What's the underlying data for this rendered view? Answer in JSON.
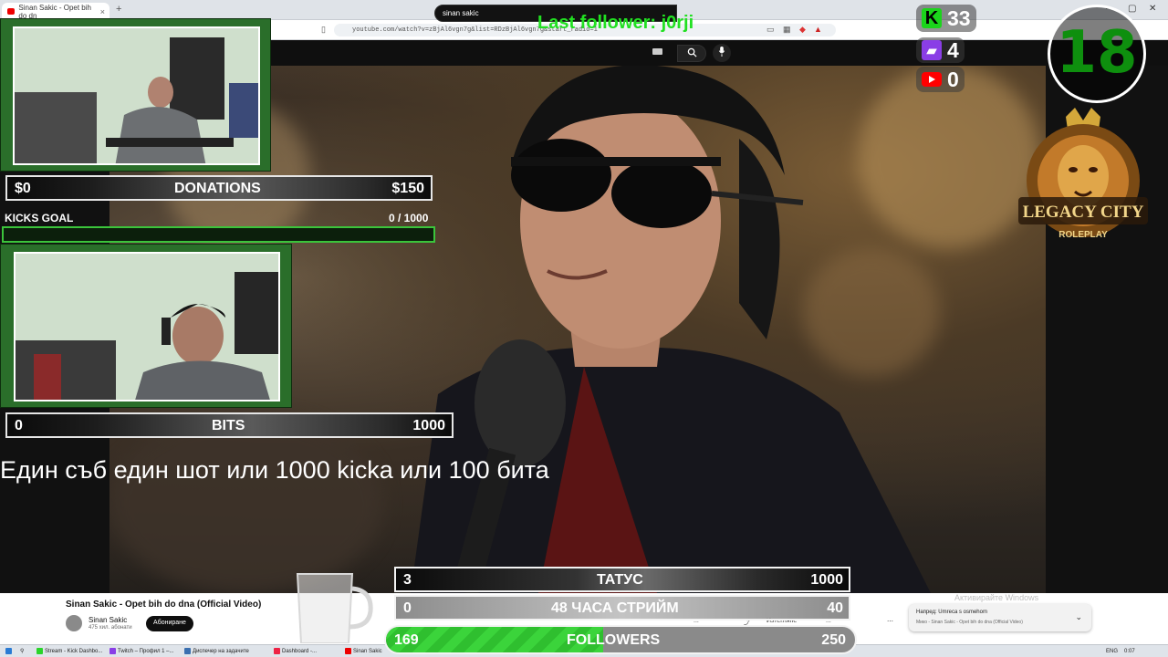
{
  "browser": {
    "tab_title": "Sinan Sakic - Opet bih do dn",
    "new_tab": "+",
    "close_tab": "×",
    "url": "youtube.com/watch?v=zBjAl6vgn7g&list=RDzBjAl6vgn7g&start_radio=1",
    "window_controls": [
      "—",
      "▢",
      "✕"
    ]
  },
  "youtube": {
    "search_value": "sinan sakic",
    "search_icon": "search-icon",
    "mic_icon": "mic-icon",
    "video_title": "Sinan Sakic - Opet bih do dna (Official Video)",
    "channel_name": "Sinan Sakic",
    "channel_subs": "475 хил. абонати",
    "subscribe_label": "Абониране",
    "actions": [
      "...",
      "Изтегляне",
      "..."
    ],
    "more": "⋯"
  },
  "overlay": {
    "last_follower": "Last follower: j0rji",
    "kick_count": "33",
    "twitch_count": "4",
    "youtube_count": "0",
    "age_badge": "18",
    "logo_text_1": "LEGACY CITY",
    "logo_text_2": "ROLEPLAY",
    "donations": {
      "min": "$0",
      "label": "DONATIONS",
      "max": "$150"
    },
    "kicks_goal": {
      "label": "KICKS GOAL",
      "value": "0  / 1000",
      "progress": 0
    },
    "bits": {
      "min": "0",
      "label": "BITS",
      "max": "1000"
    },
    "goal_text": "Един съб един шот  или 1000 kicka  или 100 бита",
    "tattoo": {
      "current": "3",
      "label": "ТАТУС",
      "max": "1000"
    },
    "stream48": {
      "current": "0",
      "label": "48 ЧАСА СТРИЙМ",
      "max": "40"
    },
    "followers": {
      "current": "169",
      "label": "FOLLOWERS",
      "max": "250",
      "progress": 0.676
    }
  },
  "notification": {
    "line1": "Напред: Umreca s osmehom",
    "line2": "Мико - Sinan Sakic - Opet bih do dna (Official Video)",
    "win_activate": "Активирайте Windows",
    "win_activate_sub": "Отидете в настройките, за да активирате Windows."
  },
  "taskbar": {
    "items": [
      "Sinan Sakic...",
      "Stream - Kick Dashbo...",
      "Twitch – Профил 1 –...",
      "Диспечер на задачите",
      "Dashboard -...",
      "Sinan Sakic"
    ],
    "lang": "ENG",
    "time": "0:07"
  },
  "colors": {
    "kick_green": "#1bd41b",
    "twitch_purple": "#8a3ee6",
    "youtube_red": "#ff0000",
    "overlay_green": "#21e021"
  }
}
